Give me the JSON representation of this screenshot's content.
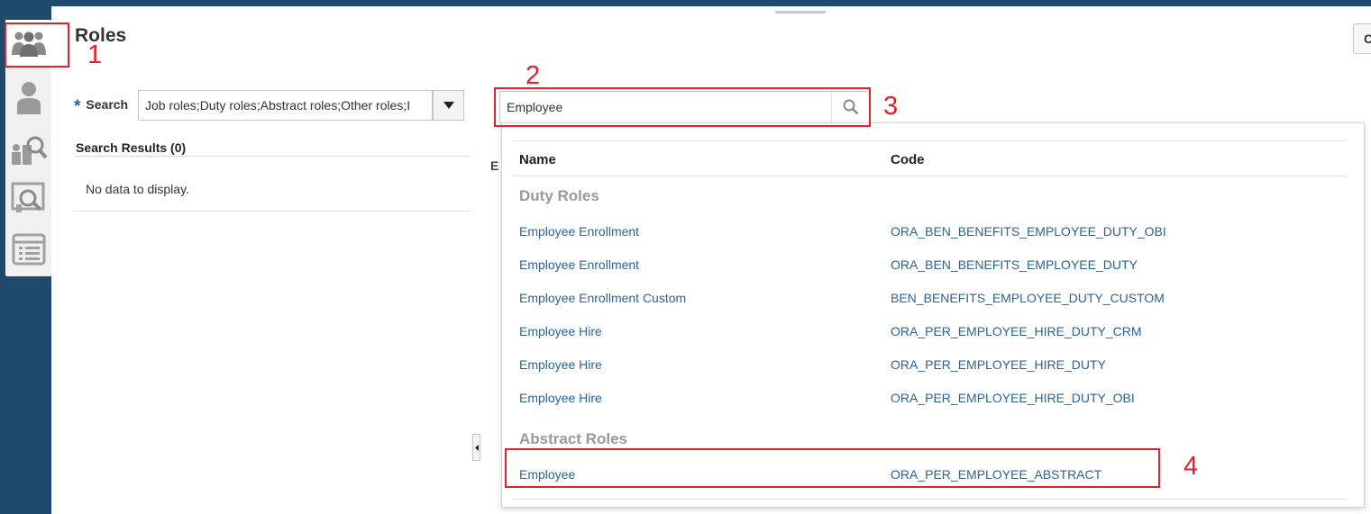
{
  "page": {
    "title": "Roles",
    "top_right_button": "C"
  },
  "sidebar": {
    "items": [
      {
        "icon": "roles-group-icon",
        "active": true
      },
      {
        "icon": "user-icon",
        "active": false
      },
      {
        "icon": "users-search-icon",
        "active": false
      },
      {
        "icon": "certificate-search-icon",
        "active": false
      },
      {
        "icon": "list-icon",
        "active": false
      }
    ]
  },
  "search": {
    "label": "Search",
    "required_mark": "*",
    "role_types_value": "Job roles;Duty roles;Abstract roles;Other roles;I",
    "keyword_value": "Employee"
  },
  "results": {
    "title": "Search Results (0)",
    "empty_message": "No data to display.",
    "partial_label": "E"
  },
  "dropdown": {
    "columns": {
      "name": "Name",
      "code": "Code"
    },
    "groups": [
      {
        "label": "Duty Roles",
        "rows": [
          {
            "name": "Employee Enrollment",
            "code": "ORA_BEN_BENEFITS_EMPLOYEE_DUTY_OBI"
          },
          {
            "name": "Employee Enrollment",
            "code": "ORA_BEN_BENEFITS_EMPLOYEE_DUTY"
          },
          {
            "name": "Employee Enrollment Custom",
            "code": "BEN_BENEFITS_EMPLOYEE_DUTY_CUSTOM"
          },
          {
            "name": "Employee Hire",
            "code": "ORA_PER_EMPLOYEE_HIRE_DUTY_CRM"
          },
          {
            "name": "Employee Hire",
            "code": "ORA_PER_EMPLOYEE_HIRE_DUTY"
          },
          {
            "name": "Employee Hire",
            "code": "ORA_PER_EMPLOYEE_HIRE_DUTY_OBI"
          }
        ]
      },
      {
        "label": "Abstract Roles",
        "rows": [
          {
            "name": "Employee",
            "code": "ORA_PER_EMPLOYEE_ABSTRACT"
          }
        ]
      }
    ]
  },
  "annotations": [
    "1",
    "2",
    "3",
    "4"
  ],
  "colors": {
    "frame": "#1f4a6e",
    "link": "#2a6496",
    "annotation": "#e0222a",
    "required": "#1a64a4"
  }
}
